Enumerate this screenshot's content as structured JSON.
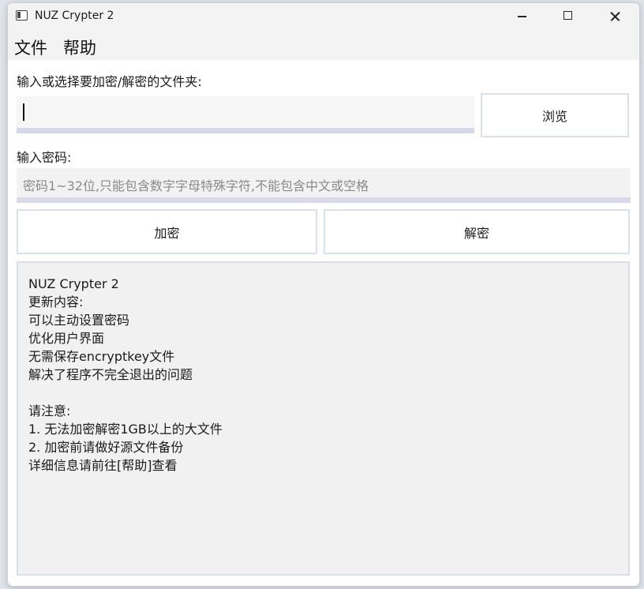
{
  "window": {
    "title": "NUZ Crypter 2"
  },
  "menubar": {
    "items": [
      {
        "label": "文件"
      },
      {
        "label": "帮助"
      }
    ]
  },
  "folder": {
    "label": "输入或选择要加密/解密的文件夹:",
    "value": "",
    "browse_label": "浏览"
  },
  "password": {
    "label": "输入密码:",
    "value": "",
    "placeholder": "密码1~32位,只能包含数字字母特殊字符,不能包含中文或空格"
  },
  "actions": {
    "encrypt_label": "加密",
    "decrypt_label": "解密"
  },
  "info": {
    "lines": [
      "NUZ Crypter 2",
      "更新内容:",
      "可以主动设置密码",
      "优化用户界面",
      "无需保存encryptkey文件",
      "解决了程序不完全退出的问题",
      "",
      "请注意:",
      "1. 无法加密解密1GB以上的大文件",
      "2. 加密前请做好源文件备份",
      "详细信息请前往[帮助]查看"
    ]
  },
  "icons": {
    "app": "app-window-icon",
    "minimize": "minimize-icon",
    "maximize": "maximize-icon",
    "close": "close-icon"
  },
  "colors": {
    "titlebar_bg": "#f3f3f3",
    "input_underline": "#d7d7ea",
    "button_border": "#d8e0ec",
    "info_bg": "#f1f1f1"
  }
}
